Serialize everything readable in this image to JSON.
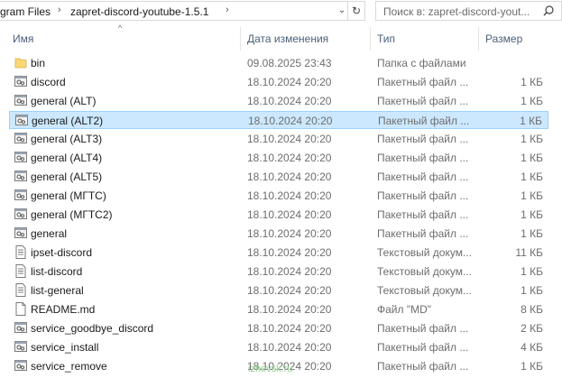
{
  "address": {
    "crumb_prev": "gram Files",
    "crumb_current": "zapret-discord-youtube-1.5.1",
    "separator": "›",
    "dropdown": "⌄",
    "refresh": "↻"
  },
  "search": {
    "placeholder": "Поиск в: zapret-discord-yout..."
  },
  "columns": {
    "name": "Имя",
    "date": "Дата изменения",
    "type": "Тип",
    "size": "Размер",
    "sort_indicator": "^"
  },
  "files": [
    {
      "name": "bin",
      "date": "09.08.2025 23:43",
      "type": "Папка с файлами",
      "size": "",
      "icon": "folder-icon"
    },
    {
      "name": "discord",
      "date": "18.10.2024 20:20",
      "type": "Пакетный файл ...",
      "size": "1 КБ",
      "icon": "batch-file-icon"
    },
    {
      "name": "general (ALT)",
      "date": "18.10.2024 20:20",
      "type": "Пакетный файл ...",
      "size": "1 КБ",
      "icon": "batch-file-icon"
    },
    {
      "name": "general (ALT2)",
      "date": "18.10.2024 20:20",
      "type": "Пакетный файл ...",
      "size": "1 КБ",
      "icon": "batch-file-icon",
      "selected": true
    },
    {
      "name": "general (ALT3)",
      "date": "18.10.2024 20:20",
      "type": "Пакетный файл ...",
      "size": "1 КБ",
      "icon": "batch-file-icon"
    },
    {
      "name": "general (ALT4)",
      "date": "18.10.2024 20:20",
      "type": "Пакетный файл ...",
      "size": "1 КБ",
      "icon": "batch-file-icon"
    },
    {
      "name": "general (ALT5)",
      "date": "18.10.2024 20:20",
      "type": "Пакетный файл ...",
      "size": "1 КБ",
      "icon": "batch-file-icon"
    },
    {
      "name": "general (МГТС)",
      "date": "18.10.2024 20:20",
      "type": "Пакетный файл ...",
      "size": "1 КБ",
      "icon": "batch-file-icon"
    },
    {
      "name": "general (МГТС2)",
      "date": "18.10.2024 20:20",
      "type": "Пакетный файл ...",
      "size": "1 КБ",
      "icon": "batch-file-icon"
    },
    {
      "name": "general",
      "date": "18.10.2024 20:20",
      "type": "Пакетный файл ...",
      "size": "1 КБ",
      "icon": "batch-file-icon"
    },
    {
      "name": "ipset-discord",
      "date": "18.10.2024 20:20",
      "type": "Текстовый докум...",
      "size": "11 КБ",
      "icon": "text-file-icon"
    },
    {
      "name": "list-discord",
      "date": "18.10.2024 20:20",
      "type": "Текстовый докум...",
      "size": "1 КБ",
      "icon": "text-file-icon"
    },
    {
      "name": "list-general",
      "date": "18.10.2024 20:20",
      "type": "Текстовый докум...",
      "size": "1 КБ",
      "icon": "text-file-icon"
    },
    {
      "name": "README.md",
      "date": "18.10.2024 20:20",
      "type": "Файл \"MD\"",
      "size": "8 КБ",
      "icon": "blank-file-icon"
    },
    {
      "name": "service_goodbye_discord",
      "date": "18.10.2024 20:20",
      "type": "Пакетный файл ...",
      "size": "2 КБ",
      "icon": "batch-file-icon"
    },
    {
      "name": "service_install",
      "date": "18.10.2024 20:20",
      "type": "Пакетный файл ...",
      "size": "4 КБ",
      "icon": "batch-file-icon"
    },
    {
      "name": "service_remove",
      "date": "18.10.2024 20:20",
      "type": "Пакетный файл ...",
      "size": "1 КБ",
      "icon": "batch-file-icon"
    }
  ],
  "watermark": "izhevsk.ru",
  "colors": {
    "selection_bg": "#cce8ff",
    "selection_border": "#99d1ff",
    "header_text": "#4c607a"
  }
}
